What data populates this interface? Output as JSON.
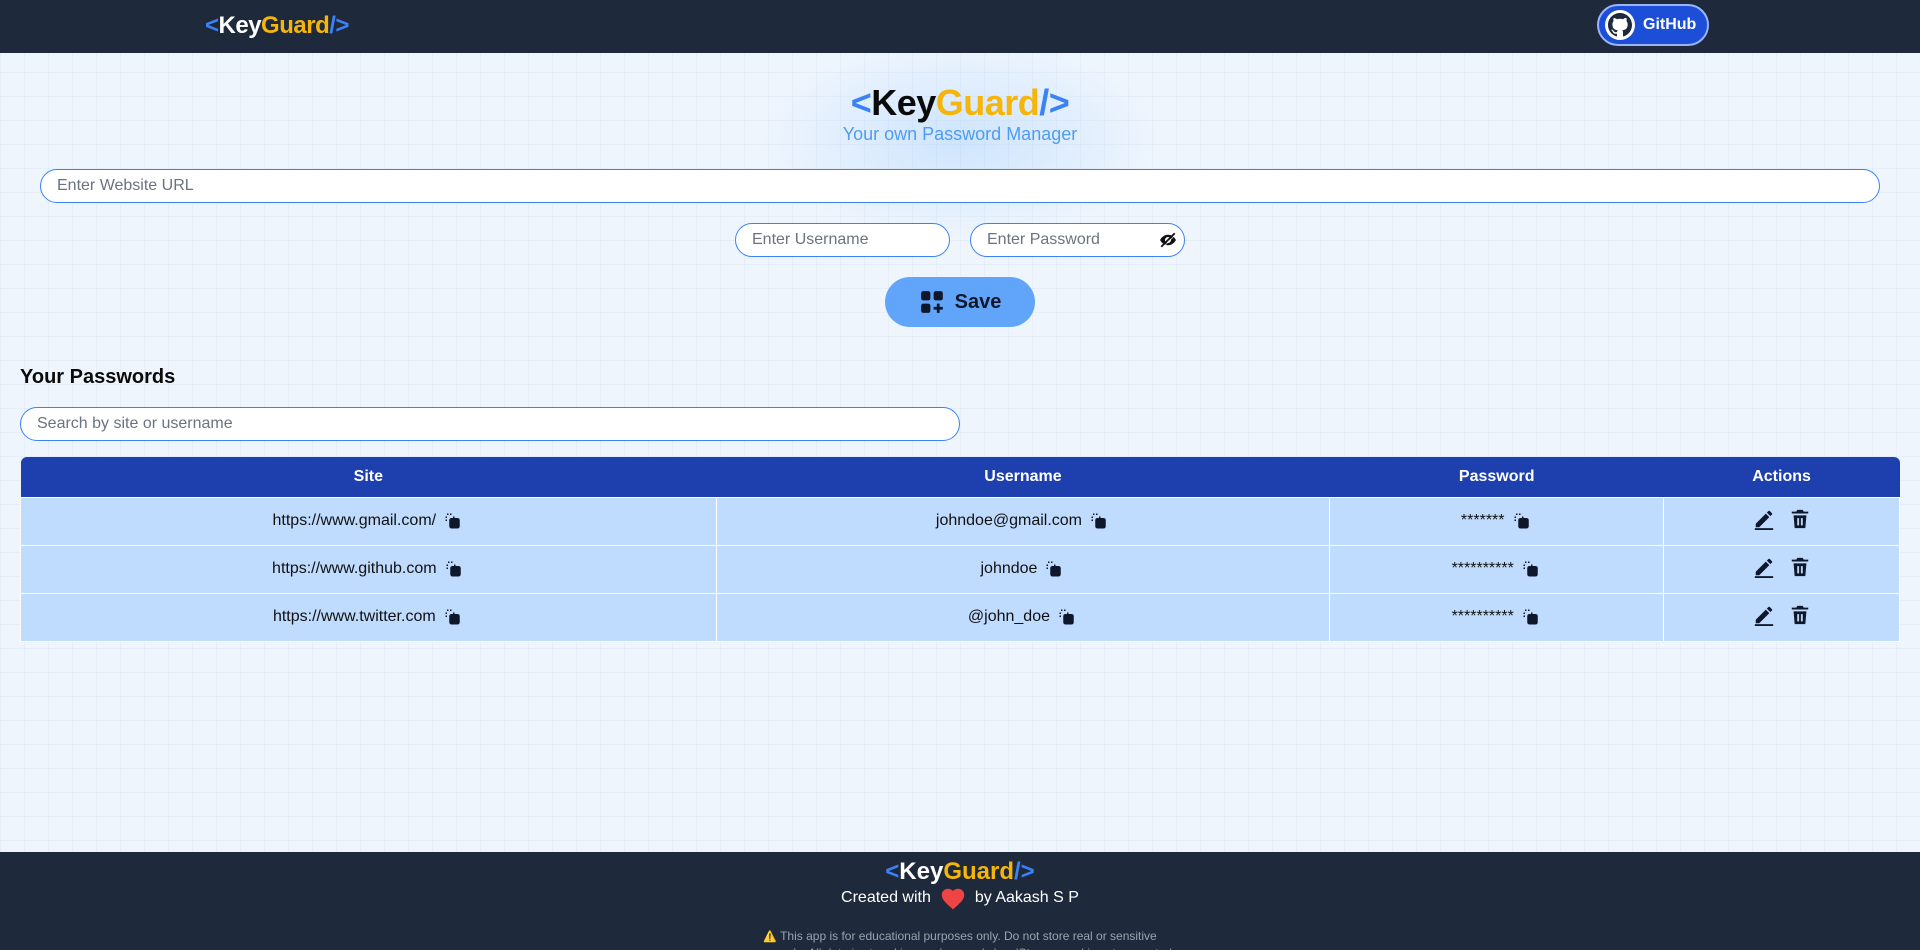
{
  "navbar": {
    "logo": {
      "lt": "<",
      "key": "Key",
      "guard": "Guard",
      "end": "/>"
    },
    "github_label": "GitHub"
  },
  "hero": {
    "logo": {
      "lt": "<",
      "key": "Key",
      "guard": "Guard",
      "end": "/>"
    },
    "tagline": "Your own Password Manager"
  },
  "form": {
    "url_placeholder": "Enter Website URL",
    "username_placeholder": "Enter Username",
    "password_placeholder": "Enter Password",
    "save_label": "Save"
  },
  "passwords": {
    "title": "Your Passwords",
    "search_placeholder": "Search by site or username",
    "columns": [
      "Site",
      "Username",
      "Password",
      "Actions"
    ],
    "rows": [
      {
        "site": "https://www.gmail.com/",
        "username": "johndoe@gmail.com",
        "password": "*******"
      },
      {
        "site": "https://www.github.com",
        "username": "johndoe",
        "password": "**********"
      },
      {
        "site": "https://www.twitter.com",
        "username": "@john_doe",
        "password": "**********"
      }
    ]
  },
  "footer": {
    "logo": {
      "lt": "<",
      "key": "Key",
      "guard": "Guard",
      "end": "/>"
    },
    "created_with": "Created with",
    "by": "by Aakash S P",
    "warning_icon": "⚠️",
    "note": "This app is for educational purposes only. Do not store real or sensitive passwords. All data is stored in your browser's localStorage and is not encrypted."
  },
  "colors": {
    "navbar_bg": "#1e293b",
    "accent_blue": "#3b82f6",
    "logo_gold": "#f5b50a",
    "table_header": "#1e40af",
    "table_row": "#bfdbfe",
    "save_button": "#60a5fa",
    "heart": "#ef4444"
  },
  "icons": {
    "github": "github-icon",
    "eye": "eye-slash-icon",
    "save": "grid-plus-icon",
    "copy": "copy-icon",
    "edit": "pencil-icon",
    "delete": "trash-icon",
    "heart": "heart-icon"
  }
}
